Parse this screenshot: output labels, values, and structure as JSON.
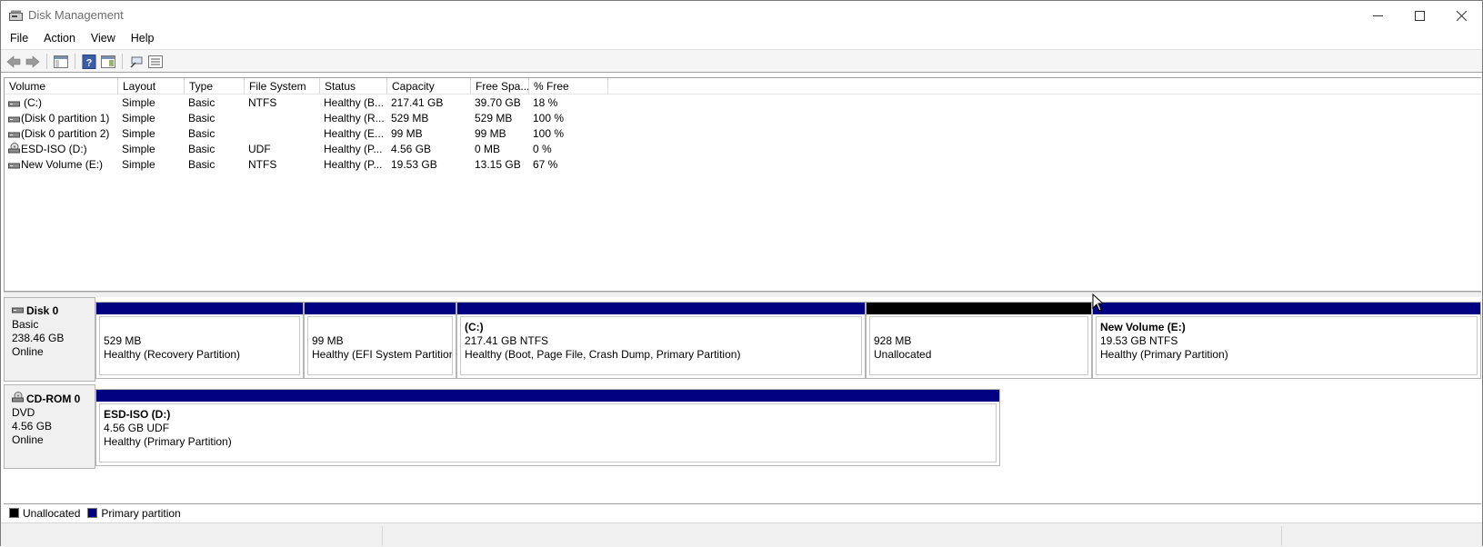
{
  "window": {
    "title": "Disk Management"
  },
  "menu": [
    "File",
    "Action",
    "View",
    "Help"
  ],
  "toolbar": {
    "buttons": [
      "back-arrow-icon",
      "forward-arrow-icon",
      "console-tree-icon",
      "help-icon",
      "show-pane-icon",
      "properties-icon",
      "list-view-icon"
    ]
  },
  "volume_list": {
    "columns": [
      "Volume",
      "Layout",
      "Type",
      "File System",
      "Status",
      "Capacity",
      "Free Spa...",
      "% Free"
    ],
    "rows": [
      {
        "volume": "(C:)",
        "icon": "drive-icon",
        "layout": "Simple",
        "type": "Basic",
        "fs": "NTFS",
        "status": "Healthy (B...",
        "capacity": "217.41 GB",
        "free": "39.70 GB",
        "pct": "18 %"
      },
      {
        "volume": "(Disk 0 partition 1)",
        "icon": "drive-icon",
        "layout": "Simple",
        "type": "Basic",
        "fs": "",
        "status": "Healthy (R...",
        "capacity": "529 MB",
        "free": "529 MB",
        "pct": "100 %"
      },
      {
        "volume": "(Disk 0 partition 2)",
        "icon": "drive-icon",
        "layout": "Simple",
        "type": "Basic",
        "fs": "",
        "status": "Healthy (E...",
        "capacity": "99 MB",
        "free": "99 MB",
        "pct": "100 %"
      },
      {
        "volume": "ESD-ISO (D:)",
        "icon": "cd-icon",
        "layout": "Simple",
        "type": "Basic",
        "fs": "UDF",
        "status": "Healthy (P...",
        "capacity": "4.56 GB",
        "free": "0 MB",
        "pct": "0 %"
      },
      {
        "volume": "New Volume (E:)",
        "icon": "drive-icon",
        "layout": "Simple",
        "type": "Basic",
        "fs": "NTFS",
        "status": "Healthy (P...",
        "capacity": "19.53 GB",
        "free": "13.15 GB",
        "pct": "67 %"
      }
    ]
  },
  "disks": [
    {
      "name": "Disk 0",
      "type": "Basic",
      "size": "238.46 GB",
      "state": "Online",
      "partitions": [
        {
          "title": "",
          "line1": "529 MB",
          "line2": "Healthy (Recovery Partition)",
          "kind": "primary"
        },
        {
          "title": "",
          "line1": "99 MB",
          "line2": "Healthy (EFI System Partition)",
          "kind": "primary"
        },
        {
          "title": "(C:)",
          "line1": "217.41 GB NTFS",
          "line2": "Healthy (Boot, Page File, Crash Dump, Primary Partition)",
          "kind": "primary"
        },
        {
          "title": "",
          "line1": "928 MB",
          "line2": "Unallocated",
          "kind": "unallocated"
        },
        {
          "title": "New Volume  (E:)",
          "line1": "19.53 GB NTFS",
          "line2": "Healthy (Primary Partition)",
          "kind": "primary"
        }
      ]
    },
    {
      "name": "CD-ROM 0",
      "type": "DVD",
      "size": "4.56 GB",
      "state": "Online",
      "partitions": [
        {
          "title": "ESD-ISO  (D:)",
          "line1": "4.56 GB UDF",
          "line2": "Healthy (Primary Partition)",
          "kind": "primary"
        }
      ]
    }
  ],
  "legend": [
    {
      "label": "Unallocated",
      "color": "#000000"
    },
    {
      "label": "Primary partition",
      "color": "#000080"
    }
  ],
  "colors": {
    "primary": "#000080",
    "unallocated": "#000000"
  }
}
